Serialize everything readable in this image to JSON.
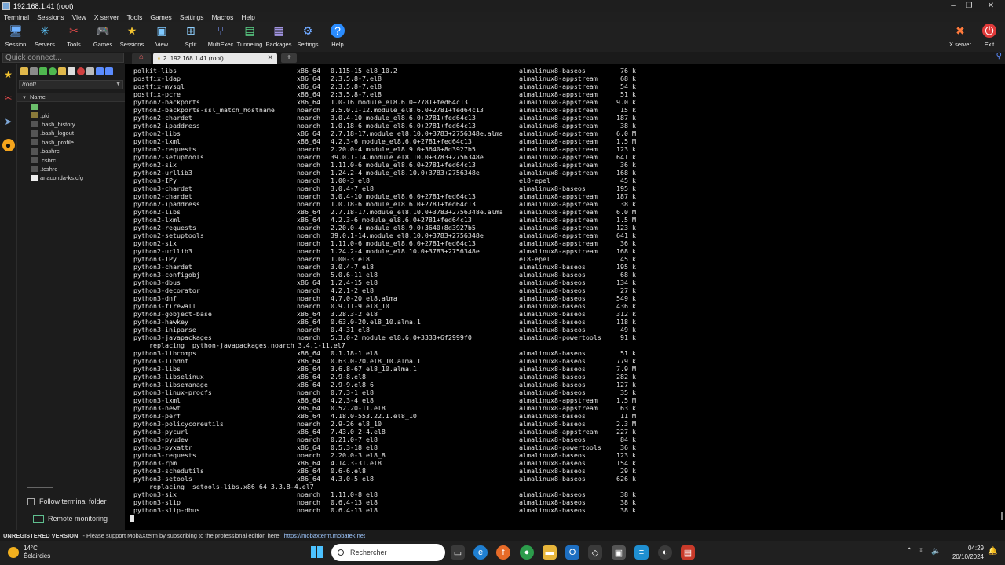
{
  "window": {
    "title": "192.168.1.41 (root)"
  },
  "menu": [
    "Terminal",
    "Sessions",
    "View",
    "X server",
    "Tools",
    "Games",
    "Settings",
    "Macros",
    "Help"
  ],
  "toolbar": {
    "items": [
      "Session",
      "Servers",
      "Tools",
      "Games",
      "Sessions",
      "View",
      "Split",
      "MultiExec",
      "Tunneling",
      "Packages",
      "Settings",
      "Help"
    ],
    "right": [
      "X server",
      "Exit"
    ]
  },
  "tabs": {
    "quick_connect_placeholder": "Quick connect...",
    "session_tab": "2. 192.168.1.41 (root)"
  },
  "sftp": {
    "path": "/root/",
    "column": "Name",
    "files": [
      "..",
      ".pki",
      ".bash_history",
      ".bash_logout",
      ".bash_profile",
      ".bashrc",
      ".cshrc",
      ".tcshrc",
      "anaconda-ks.cfg"
    ],
    "follow_label": "Follow terminal folder",
    "remote_label": "Remote monitoring"
  },
  "terminal": {
    "rows": [
      [
        "polkit-libs",
        "x86_64",
        "0.115-15.el8_10.2",
        "almalinux8-baseos",
        "76 k"
      ],
      [
        "postfix-ldap",
        "x86_64",
        "2:3.5.8-7.el8",
        "almalinux8-appstream",
        "68 k"
      ],
      [
        "postfix-mysql",
        "x86_64",
        "2:3.5.8-7.el8",
        "almalinux8-appstream",
        "54 k"
      ],
      [
        "postfix-pcre",
        "x86_64",
        "2:3.5.8-7.el8",
        "almalinux8-appstream",
        "51 k"
      ],
      [
        "python2-backports",
        "x86_64",
        "1.0-16.module_el8.6.0+2781+fed64c13",
        "almalinux8-appstream",
        "9.0 k"
      ],
      [
        "python2-backports-ssl_match_hostname",
        "noarch",
        "3.5.0.1-12.module_el8.6.0+2781+fed64c13",
        "almalinux8-appstream",
        "15 k"
      ],
      [
        "python2-chardet",
        "noarch",
        "3.0.4-10.module_el8.6.0+2781+fed64c13",
        "almalinux8-appstream",
        "187 k"
      ],
      [
        "python2-ipaddress",
        "noarch",
        "1.0.18-6.module_el8.6.0+2781+fed64c13",
        "almalinux8-appstream",
        "38 k"
      ],
      [
        "python2-libs",
        "x86_64",
        "2.7.18-17.module_el8.10.0+3783+2756348e.alma",
        "almalinux8-appstream",
        "6.0 M"
      ],
      [
        "python2-lxml",
        "x86_64",
        "4.2.3-6.module_el8.6.0+2781+fed64c13",
        "almalinux8-appstream",
        "1.5 M"
      ],
      [
        "python2-requests",
        "noarch",
        "2.20.0-4.module_el8.9.0+3640+8d3927b5",
        "almalinux8-appstream",
        "123 k"
      ],
      [
        "python2-setuptools",
        "noarch",
        "39.0.1-14.module_el8.10.0+3783+2756348e",
        "almalinux8-appstream",
        "641 k"
      ],
      [
        "python2-six",
        "noarch",
        "1.11.0-6.module_el8.6.0+2781+fed64c13",
        "almalinux8-appstream",
        "36 k"
      ],
      [
        "python2-urllib3",
        "noarch",
        "1.24.2-4.module_el8.10.0+3783+2756348e",
        "almalinux8-appstream",
        "168 k"
      ],
      [
        "python3-IPy",
        "noarch",
        "1.00-3.el8",
        "el8-epel",
        "45 k"
      ],
      [
        "python3-chardet",
        "noarch",
        "3.0.4-7.el8",
        "almalinux8-baseos",
        "195 k"
      ],
      [
        "python2-chardet",
        "noarch",
        "3.0.4-10.module_el8.6.0+2781+fed64c13",
        "almalinux8-appstream",
        "187 k"
      ],
      [
        "python2-ipaddress",
        "noarch",
        "1.0.18-6.module_el8.6.0+2781+fed64c13",
        "almalinux8-appstream",
        "38 k"
      ],
      [
        "python2-libs",
        "x86_64",
        "2.7.18-17.module_el8.10.0+3783+2756348e.alma",
        "almalinux8-appstream",
        "6.0 M"
      ],
      [
        "python2-lxml",
        "x86_64",
        "4.2.3-6.module_el8.6.0+2781+fed64c13",
        "almalinux8-appstream",
        "1.5 M"
      ],
      [
        "python2-requests",
        "noarch",
        "2.20.0-4.module_el8.9.0+3640+8d3927b5",
        "almalinux8-appstream",
        "123 k"
      ],
      [
        "python2-setuptools",
        "noarch",
        "39.0.1-14.module_el8.10.0+3783+2756348e",
        "almalinux8-appstream",
        "641 k"
      ],
      [
        "python2-six",
        "noarch",
        "1.11.0-6.module_el8.6.0+2781+fed64c13",
        "almalinux8-appstream",
        "36 k"
      ],
      [
        "python2-urllib3",
        "noarch",
        "1.24.2-4.module_el8.10.0+3783+2756348e",
        "almalinux8-appstream",
        "168 k"
      ],
      [
        "python3-IPy",
        "noarch",
        "1.00-3.el8",
        "el8-epel",
        "45 k"
      ],
      [
        "python3-chardet",
        "noarch",
        "3.0.4-7.el8",
        "almalinux8-baseos",
        "195 k"
      ],
      [
        "python3-configobj",
        "noarch",
        "5.0.6-11.el8",
        "almalinux8-baseos",
        "68 k"
      ],
      [
        "python3-dbus",
        "x86_64",
        "1.2.4-15.el8",
        "almalinux8-baseos",
        "134 k"
      ],
      [
        "python3-decorator",
        "noarch",
        "4.2.1-2.el8",
        "almalinux8-baseos",
        "27 k"
      ],
      [
        "python3-dnf",
        "noarch",
        "4.7.0-20.el8.alma",
        "almalinux8-baseos",
        "549 k"
      ],
      [
        "python3-firewall",
        "noarch",
        "0.9.11-9.el8_10",
        "almalinux8-baseos",
        "436 k"
      ],
      [
        "python3-gobject-base",
        "x86_64",
        "3.28.3-2.el8",
        "almalinux8-baseos",
        "312 k"
      ],
      [
        "python3-hawkey",
        "x86_64",
        "0.63.0-20.el8_10.alma.1",
        "almalinux8-baseos",
        "118 k"
      ],
      [
        "python3-iniparse",
        "noarch",
        "0.4-31.el8",
        "almalinux8-baseos",
        "49 k"
      ],
      [
        "python3-javapackages",
        "noarch",
        "5.3.0-2.module_el8.6.0+3333+6f2999f0",
        "almalinux8-powertools",
        "91 k"
      ],
      [
        "    replacing  python-javapackages.noarch 3.4.1-11.el7",
        "",
        "",
        "",
        ""
      ],
      [
        "python3-libcomps",
        "x86_64",
        "0.1.18-1.el8",
        "almalinux8-baseos",
        "51 k"
      ],
      [
        "python3-libdnf",
        "x86_64",
        "0.63.0-20.el8_10.alma.1",
        "almalinux8-baseos",
        "779 k"
      ],
      [
        "python3-libs",
        "x86_64",
        "3.6.8-67.el8_10.alma.1",
        "almalinux8-baseos",
        "7.9 M"
      ],
      [
        "python3-libselinux",
        "x86_64",
        "2.9-8.el8",
        "almalinux8-baseos",
        "282 k"
      ],
      [
        "python3-libsemanage",
        "x86_64",
        "2.9-9.el8_6",
        "almalinux8-baseos",
        "127 k"
      ],
      [
        "python3-linux-procfs",
        "noarch",
        "0.7.3-1.el8",
        "almalinux8-baseos",
        "35 k"
      ],
      [
        "python3-lxml",
        "x86_64",
        "4.2.3-4.el8",
        "almalinux8-appstream",
        "1.5 M"
      ],
      [
        "python3-newt",
        "x86_64",
        "0.52.20-11.el8",
        "almalinux8-appstream",
        "63 k"
      ],
      [
        "python3-perf",
        "x86_64",
        "4.18.0-553.22.1.el8_10",
        "almalinux8-baseos",
        "11 M"
      ],
      [
        "python3-policycoreutils",
        "noarch",
        "2.9-26.el8_10",
        "almalinux8-baseos",
        "2.3 M"
      ],
      [
        "python3-pycurl",
        "x86_64",
        "7.43.0.2-4.el8",
        "almalinux8-appstream",
        "227 k"
      ],
      [
        "python3-pyudev",
        "noarch",
        "0.21.0-7.el8",
        "almalinux8-baseos",
        "84 k"
      ],
      [
        "python3-pyxattr",
        "x86_64",
        "0.5.3-18.el8",
        "almalinux8-powertools",
        "36 k"
      ],
      [
        "python3-requests",
        "noarch",
        "2.20.0-3.el8_8",
        "almalinux8-baseos",
        "123 k"
      ],
      [
        "python3-rpm",
        "x86_64",
        "4.14.3-31.el8",
        "almalinux8-baseos",
        "154 k"
      ],
      [
        "python3-schedutils",
        "x86_64",
        "0.6-6.el8",
        "almalinux8-baseos",
        "29 k"
      ],
      [
        "python3-setools",
        "x86_64",
        "4.3.0-5.el8",
        "almalinux8-baseos",
        "626 k"
      ],
      [
        "    replacing  setools-libs.x86_64 3.3.8-4.el7",
        "",
        "",
        "",
        ""
      ],
      [
        "python3-six",
        "noarch",
        "1.11.0-8.el8",
        "almalinux8-baseos",
        "38 k"
      ],
      [
        "python3-slip",
        "noarch",
        "0.6.4-13.el8",
        "almalinux8-baseos",
        "38 k"
      ],
      [
        "python3-slip-dbus",
        "noarch",
        "0.6.4-13.el8",
        "almalinux8-baseos",
        "38 k"
      ]
    ]
  },
  "statusbar": {
    "edition": "UNREGISTERED VERSION",
    "message": "-  Please support MobaXterm by subscribing to the professional edition here:",
    "link": "https://mobaxterm.mobatek.net"
  },
  "taskbar": {
    "temperature": "14°C",
    "weather": "Éclaircies",
    "search": "Rechercher",
    "time": "04:29",
    "date": "20/10/2024"
  }
}
